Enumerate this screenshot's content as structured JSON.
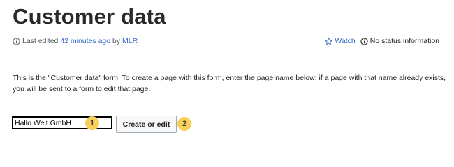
{
  "page": {
    "title": "Customer data"
  },
  "meta": {
    "last_edited_prefix": "Last edited",
    "last_edited_time": "42 minutes ago",
    "by_label": "by",
    "editor": "MLR",
    "watch_label": "Watch",
    "status_label": "No status information",
    "icons": {
      "info": "info-icon",
      "watch": "star-icon",
      "status": "status-info-icon"
    }
  },
  "intro": {
    "line1": "This is the \"Customer data\" form. To create a page with this form, enter the page name below; if a page with that name already exists,",
    "line2": "you will be sent to a form to edit that page."
  },
  "form": {
    "input_value": "Hallo Welt GmbH",
    "submit_label": "Create or edit"
  },
  "annotations": {
    "badge_1": "1",
    "badge_2": "2",
    "badge_color": "#f8cf57"
  },
  "colors": {
    "link": "#3366cc",
    "meta_text": "#54595d",
    "divider": "#c8ccd1"
  }
}
